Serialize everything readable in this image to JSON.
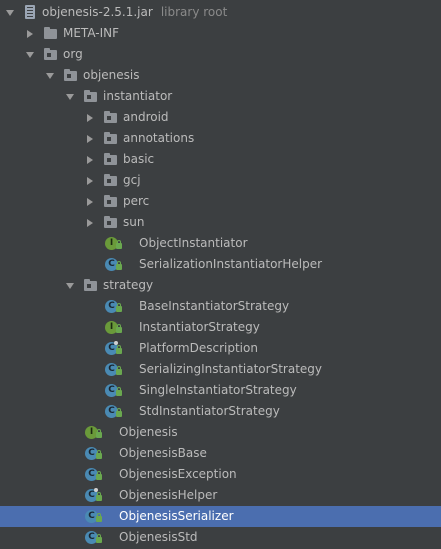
{
  "tree": {
    "root": {
      "label": "objenesis-2.5.1.jar",
      "hint": "library root"
    },
    "meta_inf": "META-INF",
    "org": "org",
    "objenesis_pkg": "objenesis",
    "instantiator_pkg": "instantiator",
    "sub_packages": [
      "android",
      "annotations",
      "basic",
      "gcj",
      "perc",
      "sun"
    ],
    "instantiator_classes": [
      "ObjectInstantiator",
      "SerializationInstantiatorHelper"
    ],
    "strategy_pkg": "strategy",
    "strategy_classes": [
      "BaseInstantiatorStrategy",
      "InstantiatorStrategy",
      "PlatformDescription",
      "SerializingInstantiatorStrategy",
      "SingleInstantiatorStrategy",
      "StdInstantiatorStrategy"
    ],
    "objenesis_classes": [
      "Objenesis",
      "ObjenesisBase",
      "ObjenesisException",
      "ObjenesisHelper",
      "ObjenesisSerializer",
      "ObjenesisStd"
    ],
    "selected": "ObjenesisSerializer"
  },
  "icons": {
    "class_letter": "C",
    "interface_letter": "I"
  },
  "colors": {
    "background": "#3c3f41",
    "selection": "#4b6eaf",
    "text": "#bbbbbb",
    "hint": "#8a8a8a",
    "class_icon": "#4a8ab3",
    "interface_icon": "#6a9a3a"
  }
}
